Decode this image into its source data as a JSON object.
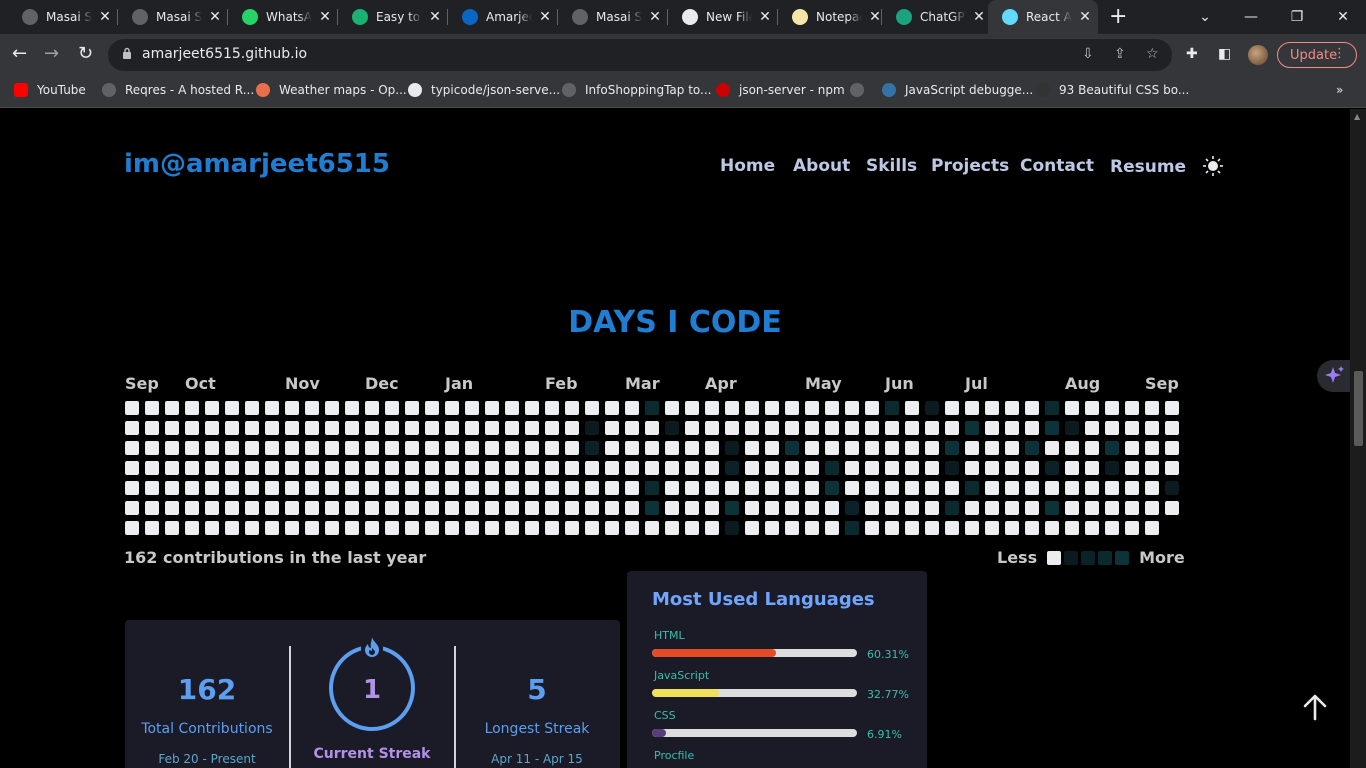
{
  "browser": {
    "tabs": [
      {
        "title": "Masai School",
        "icon": "globe-icon",
        "color": "#5f6368"
      },
      {
        "title": "Masai School",
        "icon": "globe-icon",
        "color": "#5f6368"
      },
      {
        "title": "WhatsApp",
        "icon": "whatsapp-icon",
        "color": "#25d366"
      },
      {
        "title": "Easy to use",
        "icon": "s-icon",
        "color": "#1bb173"
      },
      {
        "title": "Amarjeet",
        "icon": "linkedin-icon",
        "color": "#0a66c2"
      },
      {
        "title": "Masai School",
        "icon": "globe-icon",
        "color": "#5f6368"
      },
      {
        "title": "New File",
        "icon": "github-icon",
        "color": "#e8eaed"
      },
      {
        "title": "Notepad",
        "icon": "notepad-icon",
        "color": "#f5e6a8"
      },
      {
        "title": "ChatGPT",
        "icon": "chatgpt-icon",
        "color": "#19a37f"
      },
      {
        "title": "React App",
        "icon": "react-icon",
        "color": "#61dafb",
        "active": true
      }
    ],
    "url": "amarjeet6515.github.io",
    "update_label": "Update",
    "bookmarks": [
      {
        "label": "YouTube",
        "color": "#ff0000"
      },
      {
        "label": "Reqres - A hosted R...",
        "color": "#5f6368"
      },
      {
        "label": "Weather maps - Op...",
        "color": "#e96e4c"
      },
      {
        "label": "typicode/json-serve...",
        "color": "#e8eaed"
      },
      {
        "label": "InfoShoppingTap to...",
        "color": "#5f6368"
      },
      {
        "label": "json-server - npm",
        "color": "#cb0000"
      },
      {
        "label": "",
        "color": "#5f6368"
      },
      {
        "label": "JavaScript debugge...",
        "color": "#3572a5"
      },
      {
        "label": "93 Beautiful CSS bo...",
        "color": "#333333"
      }
    ]
  },
  "site": {
    "logo": "im@amarjeet6515",
    "nav": [
      "Home",
      "About",
      "Skills",
      "Projects",
      "Contact",
      "Resume"
    ],
    "heading": "DAYS I CODE",
    "months": [
      "Sep",
      "Oct",
      "Nov",
      "Dec",
      "Jan",
      "Feb",
      "Mar",
      "Apr",
      "May",
      "Jun",
      "Jul",
      "Aug",
      "Sep"
    ],
    "contributions_text": "162 contributions in the last year",
    "legend_less": "Less",
    "legend_more": "More",
    "colors": {
      "accent": "#1f7ed1",
      "empty_cell": "#ebedf0",
      "active_cell": "#0b2a30"
    },
    "streak": {
      "total": "162",
      "total_label": "Total Contributions",
      "total_range": "Feb 20 - Present",
      "current": "1",
      "current_label": "Current Streak",
      "longest": "5",
      "longest_label": "Longest Streak",
      "longest_range": "Apr 11 - Apr 15"
    },
    "languages": {
      "title": "Most Used Languages",
      "items": [
        {
          "name": "HTML",
          "percent_label": "60.31%",
          "value": 60.31,
          "color": "#e34c26"
        },
        {
          "name": "JavaScript",
          "percent_label": "32.77%",
          "value": 32.77,
          "color": "#f1e05a"
        },
        {
          "name": "CSS",
          "percent_label": "6.91%",
          "value": 6.91,
          "color": "#563d7c"
        },
        {
          "name": "Procfile",
          "percent_label": "",
          "value": 0,
          "color": "#3b2f63"
        }
      ]
    }
  }
}
